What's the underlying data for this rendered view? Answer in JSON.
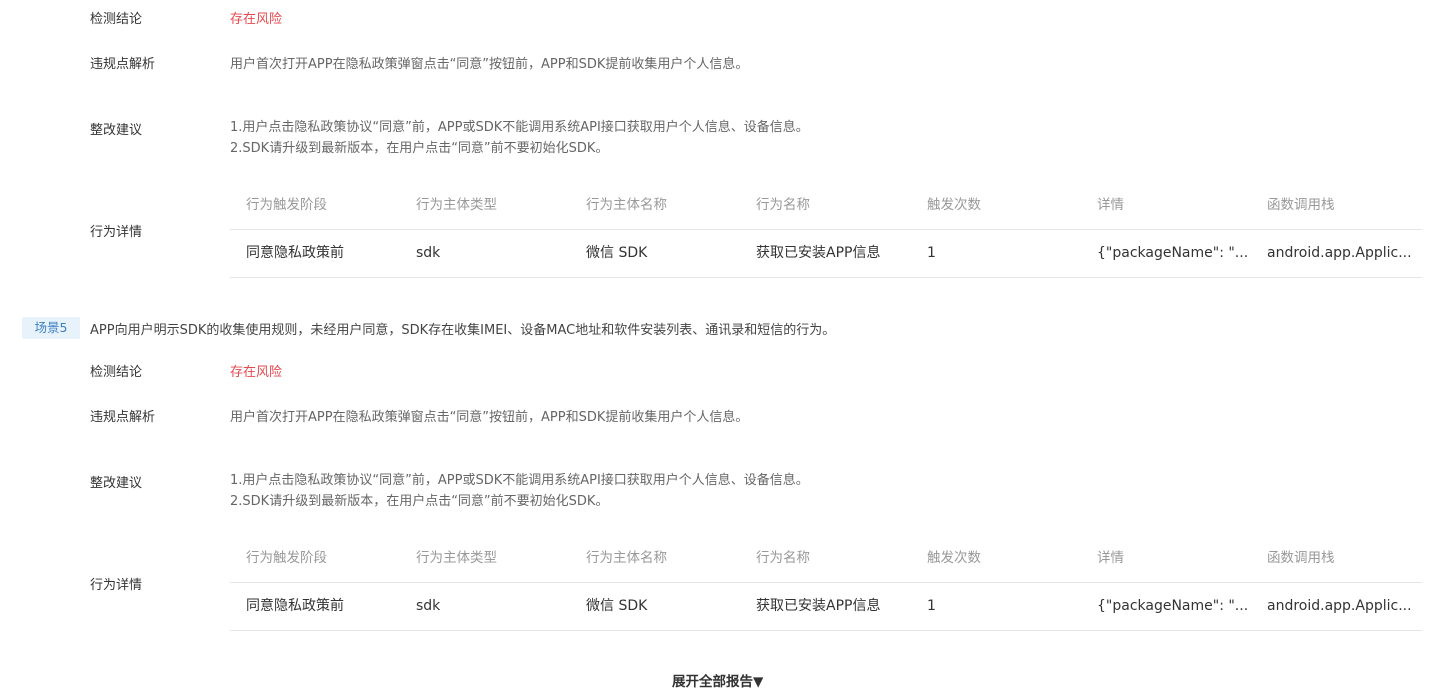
{
  "block1": {
    "conclusion_label": "检测结论",
    "conclusion_value": "存在风险",
    "analysis_label": "违规点解析",
    "analysis_value": "用户首次打开APP在隐私政策弹窗点击“同意”按钮前，APP和SDK提前收集用户个人信息。",
    "suggestion_label": "整改建议",
    "suggestion_line1": "1.用户点击隐私政策协议“同意”前，APP或SDK不能调用系统API接口获取用户个人信息、设备信息。",
    "suggestion_line2": "2.SDK请升级到最新版本，在用户点击“同意”前不要初始化SDK。",
    "detail_label": "行为详情",
    "table": {
      "headers": [
        "行为触发阶段",
        "行为主体类型",
        "行为主体名称",
        "行为名称",
        "触发次数",
        "详情",
        "函数调用栈"
      ],
      "rows": [
        [
          "同意隐私政策前",
          "sdk",
          "微信 SDK",
          "获取已安装APP信息",
          "1",
          "{\"packageName\": \"...",
          "android.app.Applic..."
        ]
      ]
    }
  },
  "scene5": {
    "tag": "场景5",
    "description": "APP向用户明示SDK的收集使用规则，未经用户同意，SDK存在收集IMEI、设备MAC地址和软件安装列表、通讯录和短信的行为。"
  },
  "block2": {
    "conclusion_label": "检测结论",
    "conclusion_value": "存在风险",
    "analysis_label": "违规点解析",
    "analysis_value": "用户首次打开APP在隐私政策弹窗点击“同意”按钮前，APP和SDK提前收集用户个人信息。",
    "suggestion_label": "整改建议",
    "suggestion_line1": "1.用户点击隐私政策协议“同意”前，APP或SDK不能调用系统API接口获取用户个人信息、设备信息。",
    "suggestion_line2": "2.SDK请升级到最新版本，在用户点击“同意”前不要初始化SDK。",
    "detail_label": "行为详情",
    "table": {
      "headers": [
        "行为触发阶段",
        "行为主体类型",
        "行为主体名称",
        "行为名称",
        "触发次数",
        "详情",
        "函数调用栈"
      ],
      "rows": [
        [
          "同意隐私政策前",
          "sdk",
          "微信 SDK",
          "获取已安装APP信息",
          "1",
          "{\"packageName\": \"...",
          "android.app.Applic..."
        ]
      ]
    }
  },
  "footer": {
    "expand_label": "展开全部报告▼"
  },
  "colors": {
    "risk": "#e5484d",
    "tag_bg": "#e8f2fb",
    "tag_text": "#3a7fc0"
  }
}
